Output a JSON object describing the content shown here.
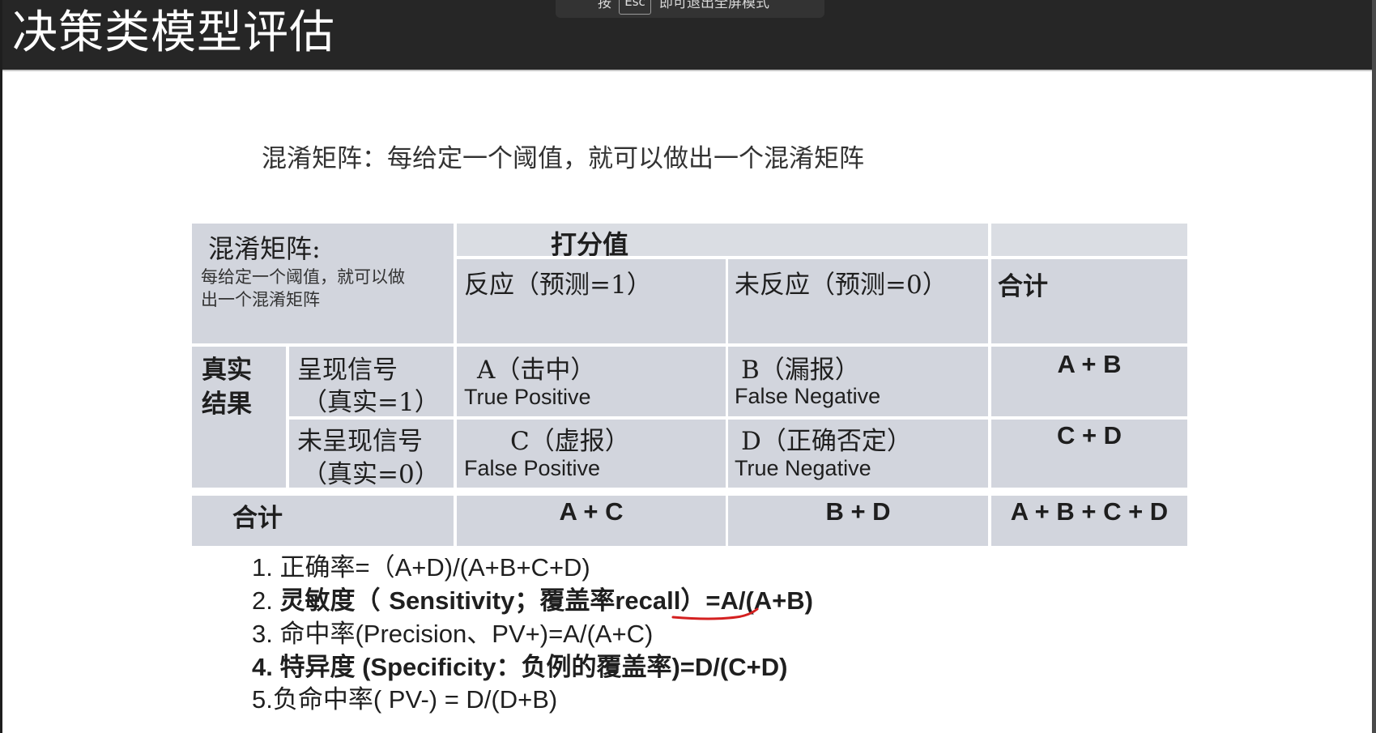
{
  "overlay": {
    "esc_hint_pre": "按",
    "esc_key": "Esc",
    "esc_hint_post": "即可退出全屏模式"
  },
  "slide": {
    "title": "决策类模型评估",
    "subtitle": "混淆矩阵：每给定一个阈值，就可以做出一个混淆矩阵"
  },
  "matrix": {
    "corner_title": "混淆矩阵:",
    "corner_note": [
      "每给定一个阈值，就可以做",
      "出一个混淆矩阵"
    ],
    "score_header": "打分值",
    "col_headers": [
      "反应（预测=1）",
      "未反应（预测=0）",
      "合计"
    ],
    "row_group": [
      "真实",
      "结果"
    ],
    "rows": [
      {
        "label": [
          "呈现信号",
          "（真实=1）"
        ],
        "cells": [
          {
            "name": "A（击中）",
            "term": "True Positive"
          },
          {
            "name": "B（漏报）",
            "term": "False Negative"
          }
        ],
        "total": "A + B"
      },
      {
        "label": [
          "未呈现信号",
          "（真实=0）"
        ],
        "cells": [
          {
            "name": "C（虚报）",
            "term": "False  Positive"
          },
          {
            "name": "D（正确否定）",
            "term": "True Negative"
          }
        ],
        "total": "C + D"
      }
    ],
    "total_row": {
      "label": "合计",
      "values": [
        "A + C",
        "B + D",
        "A + B + C + D"
      ]
    }
  },
  "formulas": [
    [
      "1. ",
      "正确率",
      "=（A+D)/(A+B+C+D)"
    ],
    [
      "2. ",
      "灵敏度（ ",
      "Sensitivity；",
      "覆盖率",
      "recall",
      "）=A/(A+B)"
    ],
    [
      "3. ",
      "命中率",
      "(Precision、PV+)=A/(A+C)"
    ],
    [
      "4. ",
      "特异度",
      " (Specificity：",
      "负例的覆盖率",
      ")=D/(C+D)"
    ],
    [
      "5.",
      "负命中率",
      "( PV-) = D/(D+B)"
    ]
  ],
  "colors": {
    "title_bar": "#262626",
    "table_cell": "#d2d5dd",
    "annotation_underline": "#d42020"
  }
}
